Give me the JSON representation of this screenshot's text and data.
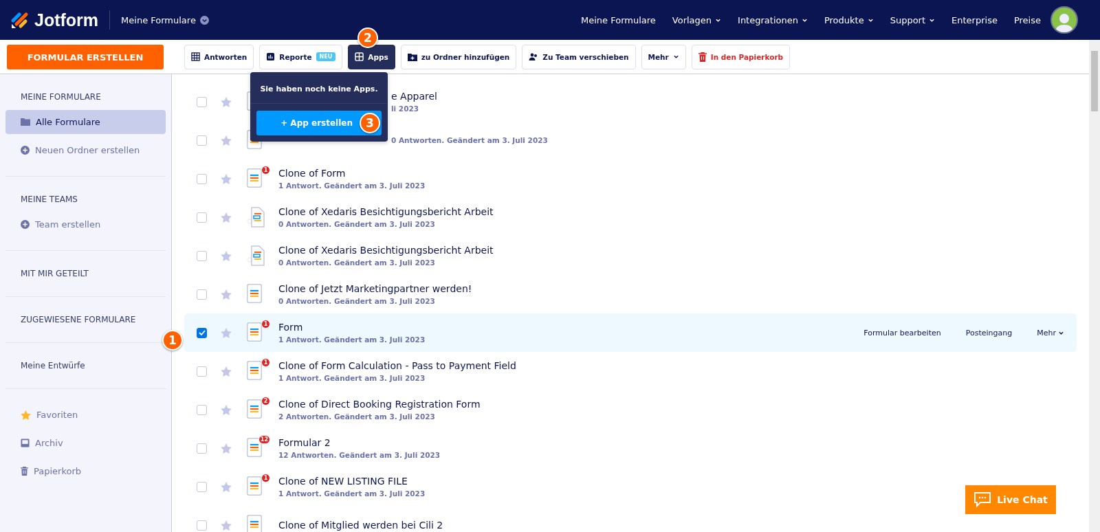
{
  "header": {
    "brand": "Jotform",
    "workspace": "Meine Formulare",
    "nav": [
      {
        "label": "Meine Formulare",
        "dropdown": false
      },
      {
        "label": "Vorlagen",
        "dropdown": true
      },
      {
        "label": "Integrationen",
        "dropdown": true
      },
      {
        "label": "Produkte",
        "dropdown": true
      },
      {
        "label": "Support",
        "dropdown": true
      },
      {
        "label": "Enterprise",
        "dropdown": false
      },
      {
        "label": "Preise",
        "dropdown": false
      }
    ]
  },
  "create_button": "FORMULAR ERSTELLEN",
  "toolbar": [
    {
      "kind": "table",
      "label": "Antworten",
      "selected": false
    },
    {
      "kind": "report",
      "label": "Reporte",
      "badge": "NEU",
      "selected": false
    },
    {
      "kind": "apps",
      "label": "Apps",
      "selected": true
    },
    {
      "kind": "folder",
      "label": "zu Ordner hinzufügen",
      "selected": false
    },
    {
      "kind": "team",
      "label": "Zu Team verschieben",
      "selected": false
    },
    {
      "kind": "more",
      "label": "Mehr",
      "selected": false
    },
    {
      "kind": "trash",
      "label": "In den Papierkorb",
      "selected": false
    }
  ],
  "apps_popover": {
    "message": "Sie haben noch keine Apps.",
    "button": "+ App erstellen"
  },
  "sidebar": {
    "sections": [
      {
        "heading": "MEINE FORMULARE",
        "items": [
          {
            "kind": "folder",
            "label": "Alle Formulare",
            "selected": true
          },
          {
            "kind": "add",
            "label": "Neuen Ordner erstellen",
            "selected": false
          }
        ]
      },
      {
        "heading": "MEINE TEAMS",
        "items": [
          {
            "kind": "add",
            "label": "Team erstellen",
            "selected": false
          }
        ]
      },
      {
        "heading": "MIT MIR GETEILT"
      },
      {
        "heading": "ZUGEWIESENE FORMULARE"
      },
      {
        "heading": "Meine Entwürfe"
      },
      {
        "items": [
          {
            "kind": "star",
            "label": "Favoriten",
            "selected": false
          },
          {
            "kind": "archive",
            "label": "Archiv",
            "selected": false
          },
          {
            "kind": "trash",
            "label": "Papierkorb",
            "selected": false
          }
        ]
      }
    ]
  },
  "forms": [
    {
      "kind": "form",
      "title": "e Apparel",
      "meta": "li 2023",
      "covered": true,
      "selected": false
    },
    {
      "kind": "form",
      "meta": "0 Antworten. Geändert am 3. Juli 2023",
      "covered": true,
      "selected": false
    },
    {
      "kind": "form",
      "title": "Clone of Form",
      "meta": "1 Antwort. Geändert am 3. Juli 2023",
      "badge": "1",
      "selected": false
    },
    {
      "kind": "import",
      "title": "Clone of Xedaris Besichtigungsbericht Arbeit",
      "meta": "0 Antworten. Geändert am 3. Juli 2023",
      "selected": false
    },
    {
      "kind": "import",
      "title": "Clone of Xedaris Besichtigungsbericht Arbeit",
      "meta": "0 Antworten. Geändert am 3. Juli 2023",
      "selected": false
    },
    {
      "kind": "form",
      "title": "Clone of Jetzt Marketingpartner werden!",
      "meta": "0 Antworten. Geändert am 3. Juli 2023",
      "selected": false
    },
    {
      "kind": "form",
      "title": "Form",
      "meta": "1 Antwort. Geändert am 3. Juli 2023",
      "badge": "1",
      "selected": true,
      "actions": [
        "Formular bearbeiten",
        "Posteingang",
        "Mehr"
      ]
    },
    {
      "kind": "form",
      "title": "Clone of Form Calculation - Pass to Payment Field",
      "meta": "1 Antwort. Geändert am 3. Juli 2023",
      "badge": "1",
      "selected": false
    },
    {
      "kind": "form",
      "title": "Clone of Direct Booking Registration Form",
      "meta": "2 Antworten. Geändert am 3. Juli 2023",
      "badge": "2",
      "selected": false
    },
    {
      "kind": "form",
      "title": "Formular 2",
      "meta": "12 Antworten. Geändert am 3. Juli 2023",
      "badge": "12",
      "selected": false
    },
    {
      "kind": "form",
      "title": "Clone of NEW LISTING FILE",
      "meta": "1 Antwort. Geändert am 3. Juli 2023",
      "badge": "1",
      "selected": false
    },
    {
      "kind": "form",
      "title": "Clone of Mitglied werden bei Cili 2",
      "selected": false
    }
  ],
  "callouts": [
    "1",
    "2",
    "3"
  ],
  "live_chat": "Live Chat"
}
